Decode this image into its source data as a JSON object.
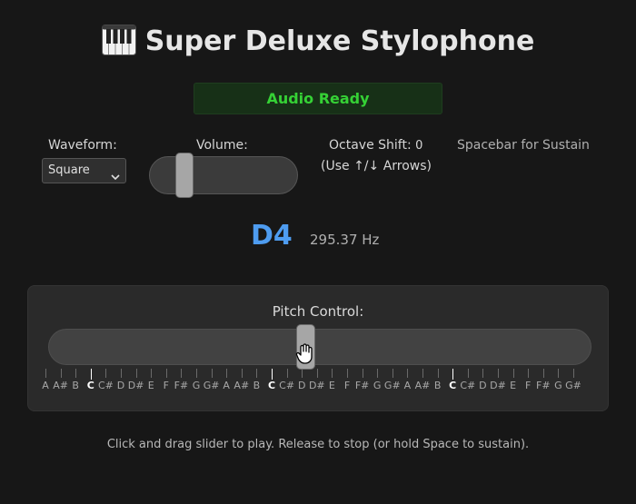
{
  "title": "Super Deluxe Stylophone",
  "status": "Audio Ready",
  "waveform": {
    "label": "Waveform:",
    "selected": "Square"
  },
  "volume": {
    "label": "Volume:",
    "level": 0.12
  },
  "octave": {
    "label": "Octave Shift:",
    "value": "0",
    "hint": "(Use ↑/↓ Arrows)"
  },
  "sustain_hint": "Spacebar for Sustain",
  "current_note": {
    "name": "D4",
    "frequency": "295.37 Hz"
  },
  "pitch": {
    "label": "Pitch Control:",
    "position": 0.47,
    "notes": [
      "A",
      "A#",
      "B",
      "C",
      "C#",
      "D",
      "D#",
      "E",
      "F",
      "F#",
      "G",
      "G#",
      "A",
      "A#",
      "B",
      "C",
      "C#",
      "D",
      "D#",
      "E",
      "F",
      "F#",
      "G",
      "G#",
      "A",
      "A#",
      "B",
      "C",
      "C#",
      "D",
      "D#",
      "E",
      "F",
      "F#",
      "G",
      "G#"
    ]
  },
  "footer": "Click and drag slider to play. Release to stop (or hold Space to sustain).",
  "colors": {
    "accent_note": "#4e9cf0",
    "status_text": "#35d135",
    "status_bg": "#173017"
  }
}
